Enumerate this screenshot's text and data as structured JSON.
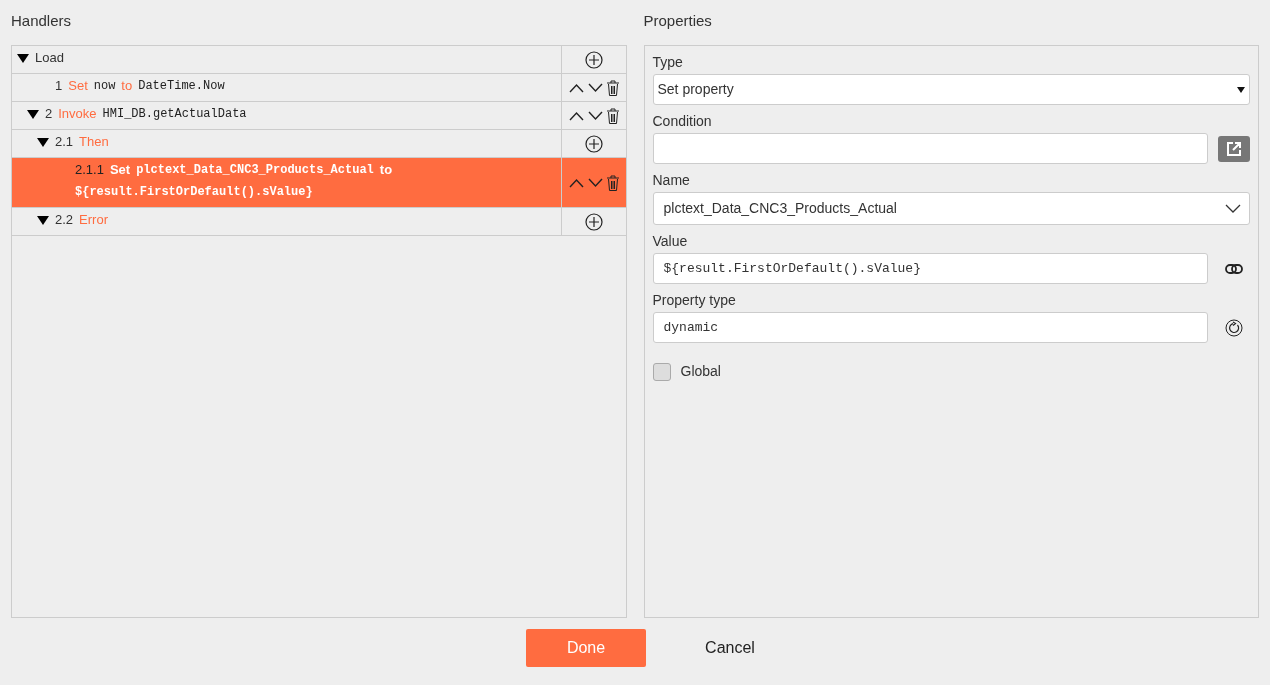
{
  "handlers": {
    "title": "Handlers",
    "tree": [
      {
        "kind": "group",
        "parts": [
          {
            "kind": "text",
            "text": "Load"
          }
        ],
        "expanded": true,
        "selected": false,
        "children": [
          {
            "kind": "step",
            "parts": [
              {
                "kind": "num",
                "text": "1"
              },
              {
                "kind": "keyword",
                "text": "Set"
              },
              {
                "kind": "code",
                "text": "now"
              },
              {
                "kind": "keyword",
                "text": "to"
              },
              {
                "kind": "code",
                "text": "DateTime.Now"
              }
            ],
            "selected": false
          },
          {
            "kind": "step",
            "parts": [
              {
                "kind": "num",
                "text": "2"
              },
              {
                "kind": "keyword",
                "text": "Invoke"
              },
              {
                "kind": "code",
                "text": "HMI_DB.getActualData"
              }
            ],
            "expanded": true,
            "selected": false,
            "children": [
              {
                "kind": "group",
                "parts": [
                  {
                    "kind": "num",
                    "text": "2.1"
                  },
                  {
                    "kind": "keyword",
                    "text": "Then"
                  }
                ],
                "expanded": true,
                "selected": false,
                "children": [
                  {
                    "kind": "step",
                    "parts": [
                      {
                        "kind": "num",
                        "text": "2.1.1"
                      },
                      {
                        "kind": "keyword",
                        "text": "Set"
                      },
                      {
                        "kind": "code",
                        "text": "plctext_Data_CNC3_Products_Actual"
                      },
                      {
                        "kind": "keyword",
                        "text": "to"
                      },
                      {
                        "kind": "code",
                        "text": "${result.FirstOrDefault().sValue}"
                      }
                    ],
                    "selected": true
                  }
                ]
              },
              {
                "kind": "group",
                "parts": [
                  {
                    "kind": "num",
                    "text": "2.2"
                  },
                  {
                    "kind": "keyword",
                    "text": "Error"
                  }
                ],
                "expanded": true,
                "selected": false
              }
            ]
          }
        ]
      }
    ]
  },
  "properties": {
    "title": "Properties",
    "fields": [
      {
        "label": "Type",
        "kind": "select",
        "value": "Set property"
      },
      {
        "label": "Condition",
        "kind": "condition"
      },
      {
        "label": "Name",
        "kind": "dropdown",
        "value": "plctext_Data_CNC3_Products_Actual"
      },
      {
        "label": "Value",
        "kind": "binding",
        "mono": true,
        "value": "${result.FirstOrDefault().sValue}"
      },
      {
        "label": "Property type",
        "kind": "typed",
        "mono": true,
        "value": "dynamic"
      },
      {
        "label": "Global",
        "kind": "checkbox",
        "checked": false
      }
    ]
  },
  "buttons": [
    {
      "label": "Done",
      "kind": "primary"
    },
    {
      "label": "Cancel",
      "kind": "plain"
    }
  ]
}
